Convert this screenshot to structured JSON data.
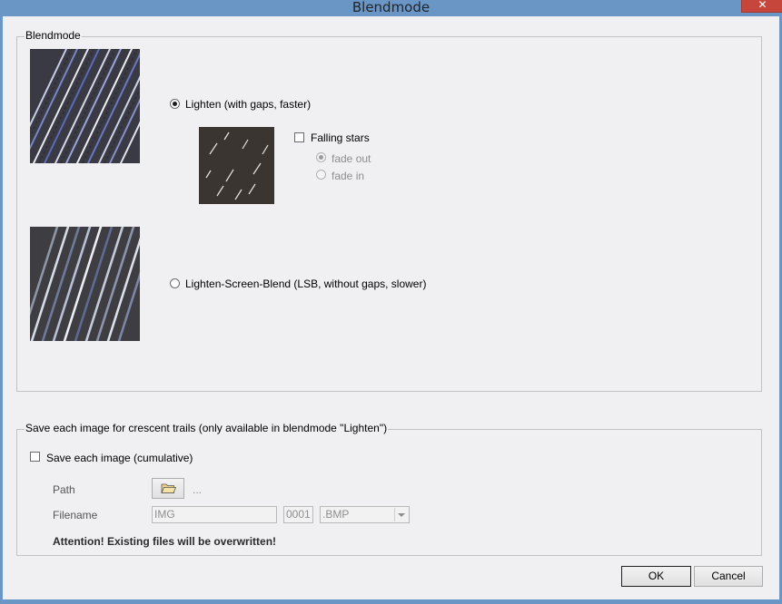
{
  "window": {
    "title": "Blendmode",
    "close_glyph": "✕"
  },
  "blendmode_group": {
    "legend": "Blendmode",
    "option_lighten": {
      "label": "Lighten (with gaps, faster)",
      "selected": true
    },
    "falling_stars": {
      "label": "Falling stars",
      "checked": false
    },
    "fade_out": {
      "label": "fade out",
      "selected": true,
      "enabled": false
    },
    "fade_in": {
      "label": "fade in",
      "selected": false,
      "enabled": false
    },
    "option_lsb": {
      "label": "Lighten-Screen-Blend (LSB, without gaps, slower)",
      "selected": false
    }
  },
  "save_group": {
    "legend": "Save each image for crescent trails (only available in blendmode \"Lighten\")",
    "save_each": {
      "label": "Save each image (cumulative)",
      "checked": false
    },
    "path_label": "Path",
    "path_value": "...",
    "filename_label": "Filename",
    "filename_prefix": "IMG",
    "filename_number": "0001",
    "filename_ext": ".BMP",
    "warning": "Attention! Existing files will be overwritten!"
  },
  "buttons": {
    "ok": "OK",
    "cancel": "Cancel"
  },
  "icons": {
    "folder": "folder-open-icon",
    "close": "close-icon",
    "dropdown": "chevron-down-icon"
  }
}
